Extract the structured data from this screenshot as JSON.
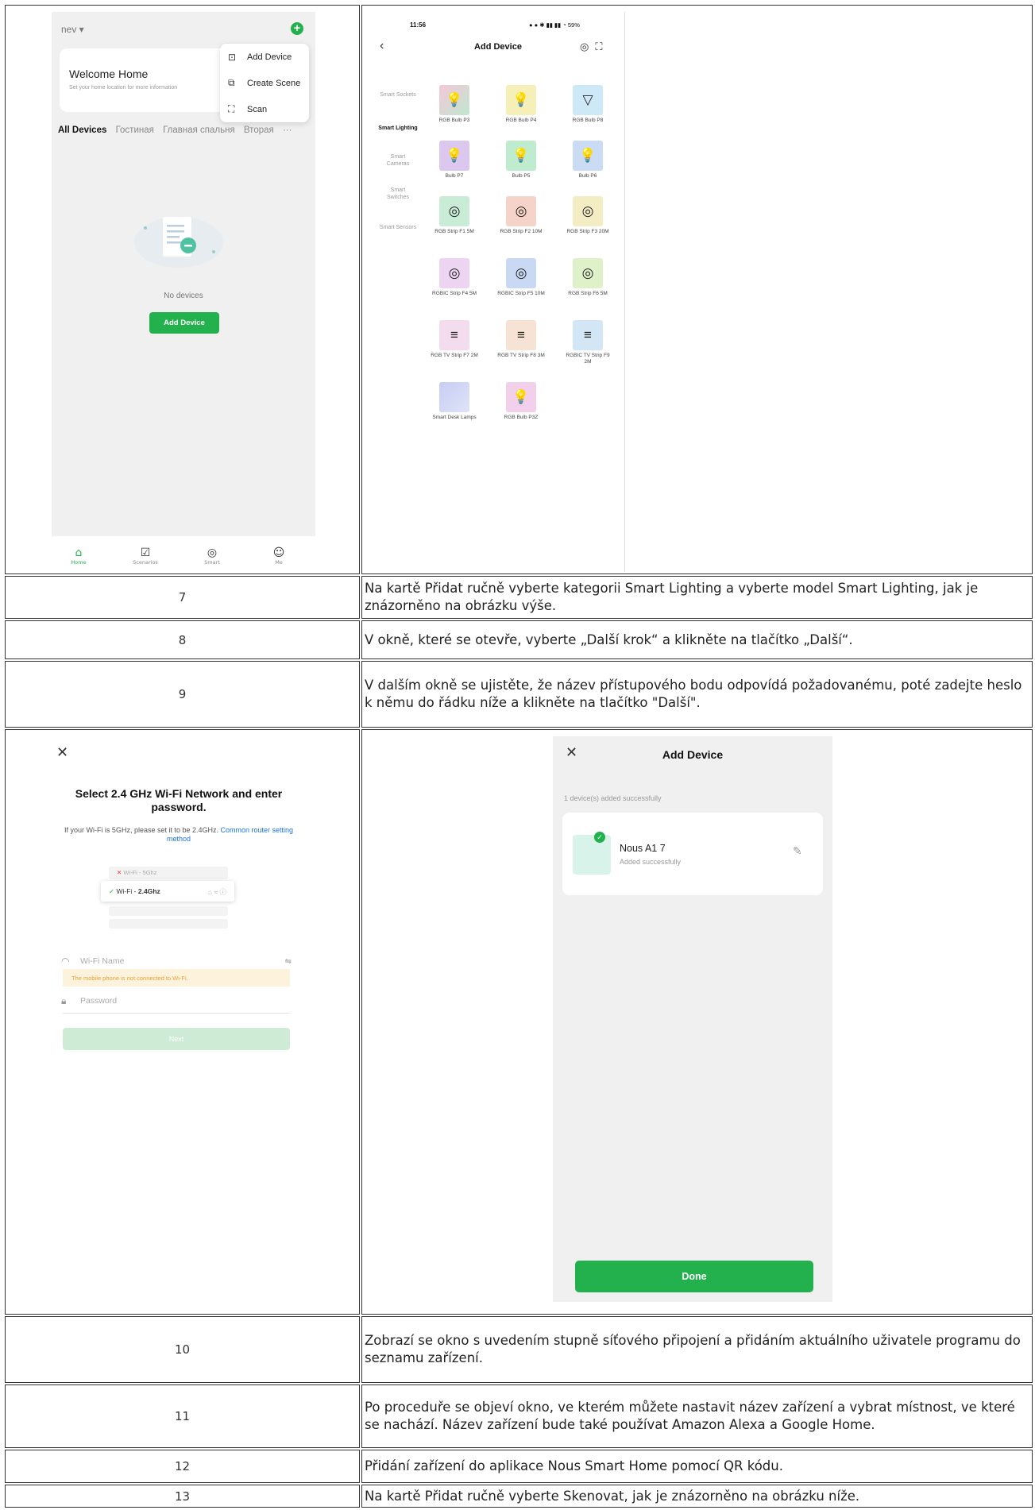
{
  "rows": {
    "r7": {
      "num": "7",
      "text": "Na kartě Přidat ručně vyberte kategorii Smart Lighting a vyberte model Smart Lighting, jak je znázorněno na obrázku výše."
    },
    "r8": {
      "num": "8",
      "text": "V okně, které se otevře, vyberte „Další krok“ a klikněte na tlačítko „Další“."
    },
    "r9": {
      "num": "9",
      "text": "V dalším okně se ujistěte, že název přístupového bodu odpovídá požadovanému, poté zadejte heslo k němu do řádku níže a klikněte na tlačítko \"Další\"."
    },
    "r10": {
      "num": "10",
      "text": "Zobrazí se okno s uvedením stupně síťového připojení a přidáním aktuálního uživatele programu do seznamu zařízení."
    },
    "r11": {
      "num": "11",
      "text": "Po proceduře se objeví okno, ve kterém můžete nastavit název zařízení a vybrat místnost, ve které se nachází. Název zařízení bude také používat Amazon Alexa a Google Home."
    },
    "r12": {
      "num": "12",
      "text": "Přidání zařízení do aplikace Nous Smart Home pomocí QR kódu."
    },
    "r13": {
      "num": "13",
      "text": "Na kartě Přidat ručně vyberte Skenovat, jak je znázorněno na obrázku níže."
    }
  },
  "screen1": {
    "home_selector": "nev ▾",
    "welcome_title": "Welcome Home",
    "welcome_sub": "Set your home location for more information",
    "popup": [
      "Add Device",
      "Create Scene",
      "Scan"
    ],
    "tabs": [
      "All Devices",
      "Гостиная",
      "Главная спальня",
      "Вторая"
    ],
    "more": "···",
    "no_devices": "No devices",
    "add_device_button": "Add Device",
    "nav": [
      "Home",
      "Scenarios",
      "Smart",
      "Me"
    ]
  },
  "screen2": {
    "time": "11:56",
    "status_right": "59%",
    "title": "Add Device",
    "categories": [
      "Smart Sockets",
      "Smart Lighting",
      "Smart Cameras",
      "Smart Switches",
      "Smart Sensors"
    ],
    "products": [
      "RGB Bulb P3",
      "RGB Bulb P4",
      "RGB Bulb P8",
      "Bulb P7",
      "Bulb P5",
      "Bulb P6",
      "RGB Strip F1 5M",
      "RGB Strip F2 10M",
      "RGB Strip F3 20M",
      "RGBIC Strip F4 5M",
      "RGBIC Strip F5 10M",
      "RGB Strip F6 5M",
      "RGB TV Strip F7 2M",
      "RGB TV Strip F8 3M",
      "RGBIC TV Strip F9 2M",
      "Smart Desk Lamps",
      "RGB Bulb P3Z"
    ]
  },
  "screen3": {
    "title": "Select 2.4 GHz Wi-Fi Network and enter password.",
    "hint": "If your Wi-Fi is 5GHz, please set it to be 2.4GHz.",
    "hint_link": "Common router setting method",
    "wifi_5": "Wi-Fi - 5Ghz",
    "wifi_24_prefix": "Wi-Fi - ",
    "wifi_24_bold": "2.4Ghz",
    "wifi_name_placeholder": "Wi-Fi Name",
    "warning": "The mobile phone is not connected to Wi-Fi.",
    "password_placeholder": "Password",
    "next": "Next"
  },
  "screen4": {
    "title": "Add Device",
    "added_count": "1 device(s) added successfully",
    "device_name": "Nous A1    7",
    "device_status": "Added successfully",
    "done": "Done"
  }
}
